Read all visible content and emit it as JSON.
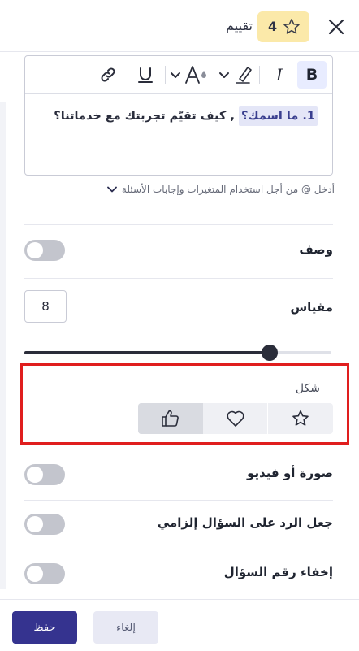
{
  "header": {
    "title": "تقييم",
    "badge_number": "4",
    "badge_color": "#fbe9a9",
    "badge_icon": "star-outline-icon",
    "close_icon": "close-icon"
  },
  "editor": {
    "toolbar": {
      "buttons": [
        "bold",
        "italic",
        "highlight-color",
        "text-color",
        "underline",
        "link"
      ],
      "bold_label": "B",
      "italic_label": "I"
    },
    "question_variable": "1. ما اسمك؟",
    "question_text": " , كيف تقيّم تجربتك مع خدماتنا؟",
    "variable_highlight_color": "#e4e6f7"
  },
  "hint": {
    "text": "أدخل @ من أجل استخدام المتغيرات وإجابات الأسئلة"
  },
  "settings": {
    "description": {
      "label": "وصف",
      "enabled": false
    },
    "scale": {
      "label": "مقياس",
      "value": "8",
      "slider_fraction": 0.8
    },
    "shape": {
      "label": "شكل",
      "options": [
        "star-icon",
        "heart-icon",
        "thumbs-up-icon"
      ],
      "selected": "thumbs-up-icon"
    },
    "image_or_video": {
      "label": "صورة أو فيديو",
      "enabled": false
    },
    "required": {
      "label": "جعل الرد على السؤال إلزامي",
      "enabled": false
    },
    "hide_number": {
      "label": "إخفاء رقم السؤال",
      "enabled": false
    }
  },
  "footer": {
    "save_label": "حفظ",
    "cancel_label": "إلغاء",
    "save_color": "#35338f"
  },
  "colors": {
    "accent": "#35338f",
    "slider": "#2a2d3a",
    "toggle_off": "#c3c5cd",
    "annotation_box": "#e01e1e"
  }
}
